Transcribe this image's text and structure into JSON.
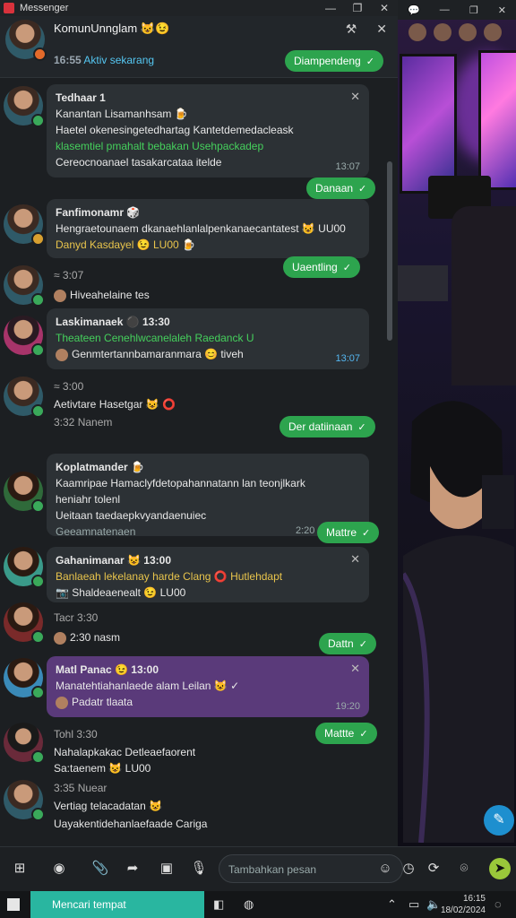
{
  "window": {
    "title": "Messenger",
    "minimize": "—",
    "restore": "❐",
    "close": "✕"
  },
  "header": {
    "name": "KomunUnnglam 😺😉",
    "status": "16:55",
    "status_link": "Aktiv sekarang",
    "pill": "Diampendeng",
    "tools": {
      "tool1": "⚒",
      "tool2": "✕"
    }
  },
  "messages": [
    {
      "name": "Tedhaar 1",
      "lines": [
        "Kanantan Lisamanhsam 🍺",
        "Haetel okenesingetedhartag Kantetdemedacleask",
        "klasemtiel pmahalt bebakan Usehpackadep",
        "Cereocnoanael tasakarcataa itelde"
      ],
      "time": "13:07",
      "pill": "Danaan"
    },
    {
      "name": "Fanfimonamr 🎲",
      "lines": [
        "Hengraetounaem dkanaehlanlalpenkanaecantatest 😺 UU00",
        "Danyd Kasdayel 😉 LU00 🍺"
      ],
      "pill": "Uaentling"
    },
    {
      "name": "≈ 3:07",
      "lines": [
        "Hiveahelaine tes"
      ]
    },
    {
      "name": "Laskimanaek ⚫ 13:30",
      "lines": [
        "Theateen Cenehlwcanelaleh Raedanck U",
        "Genmtertannbamaranmara 😊 tiveh"
      ],
      "time": "13:07"
    },
    {
      "name": "≈ 3:00",
      "lines": [
        "Aetivtare Hasetgar 😺 ⭕",
        "3:32 Nanem"
      ],
      "pill": "Der datiinaan"
    },
    {
      "name": "Koplatmander 🍺",
      "lines": [
        "Kaamripae Hamaclyfdetopahannatann lan teonjlkark",
        "heniahr tolenl",
        "Ueitaan taedaepkvyandaenuiec",
        "Geeamnatenaen"
      ],
      "time": "2:20",
      "pill": "Mattre"
    },
    {
      "name": "Gahanimanar 😺 13:00",
      "lines": [
        "Banlaeah lekelanay harde Clang ⭕ Hutlehdapt",
        "📷 Shaldeaenealt 😉 LU00"
      ]
    },
    {
      "name": "Tacr 3:30",
      "lines": [
        "2:30 nasm"
      ],
      "pill": "Dattn"
    },
    {
      "name": "Matl Panac 😉 13:00",
      "lines": [
        "Manatehtiahanlaede alam Leilan 😺 ✓",
        "Padatr tlaata"
      ],
      "time": "19:20"
    },
    {
      "name": "Tohl 3:30",
      "lines": [
        "Nahalapkakac Detleaefaorent",
        "Sa:taenem 😺 LU00"
      ],
      "pill": "Mattte"
    },
    {
      "name": "3:35 Nuear",
      "lines": [
        "Vertiag telacadatan 😺",
        "Uayakentidehanlaefaade Cariga"
      ]
    }
  ],
  "composer": {
    "placeholder": "Tambahkan pesan"
  },
  "taskbar": {
    "search": "Mencari tempat",
    "time": "16:15",
    "date": "18/02/2024"
  }
}
